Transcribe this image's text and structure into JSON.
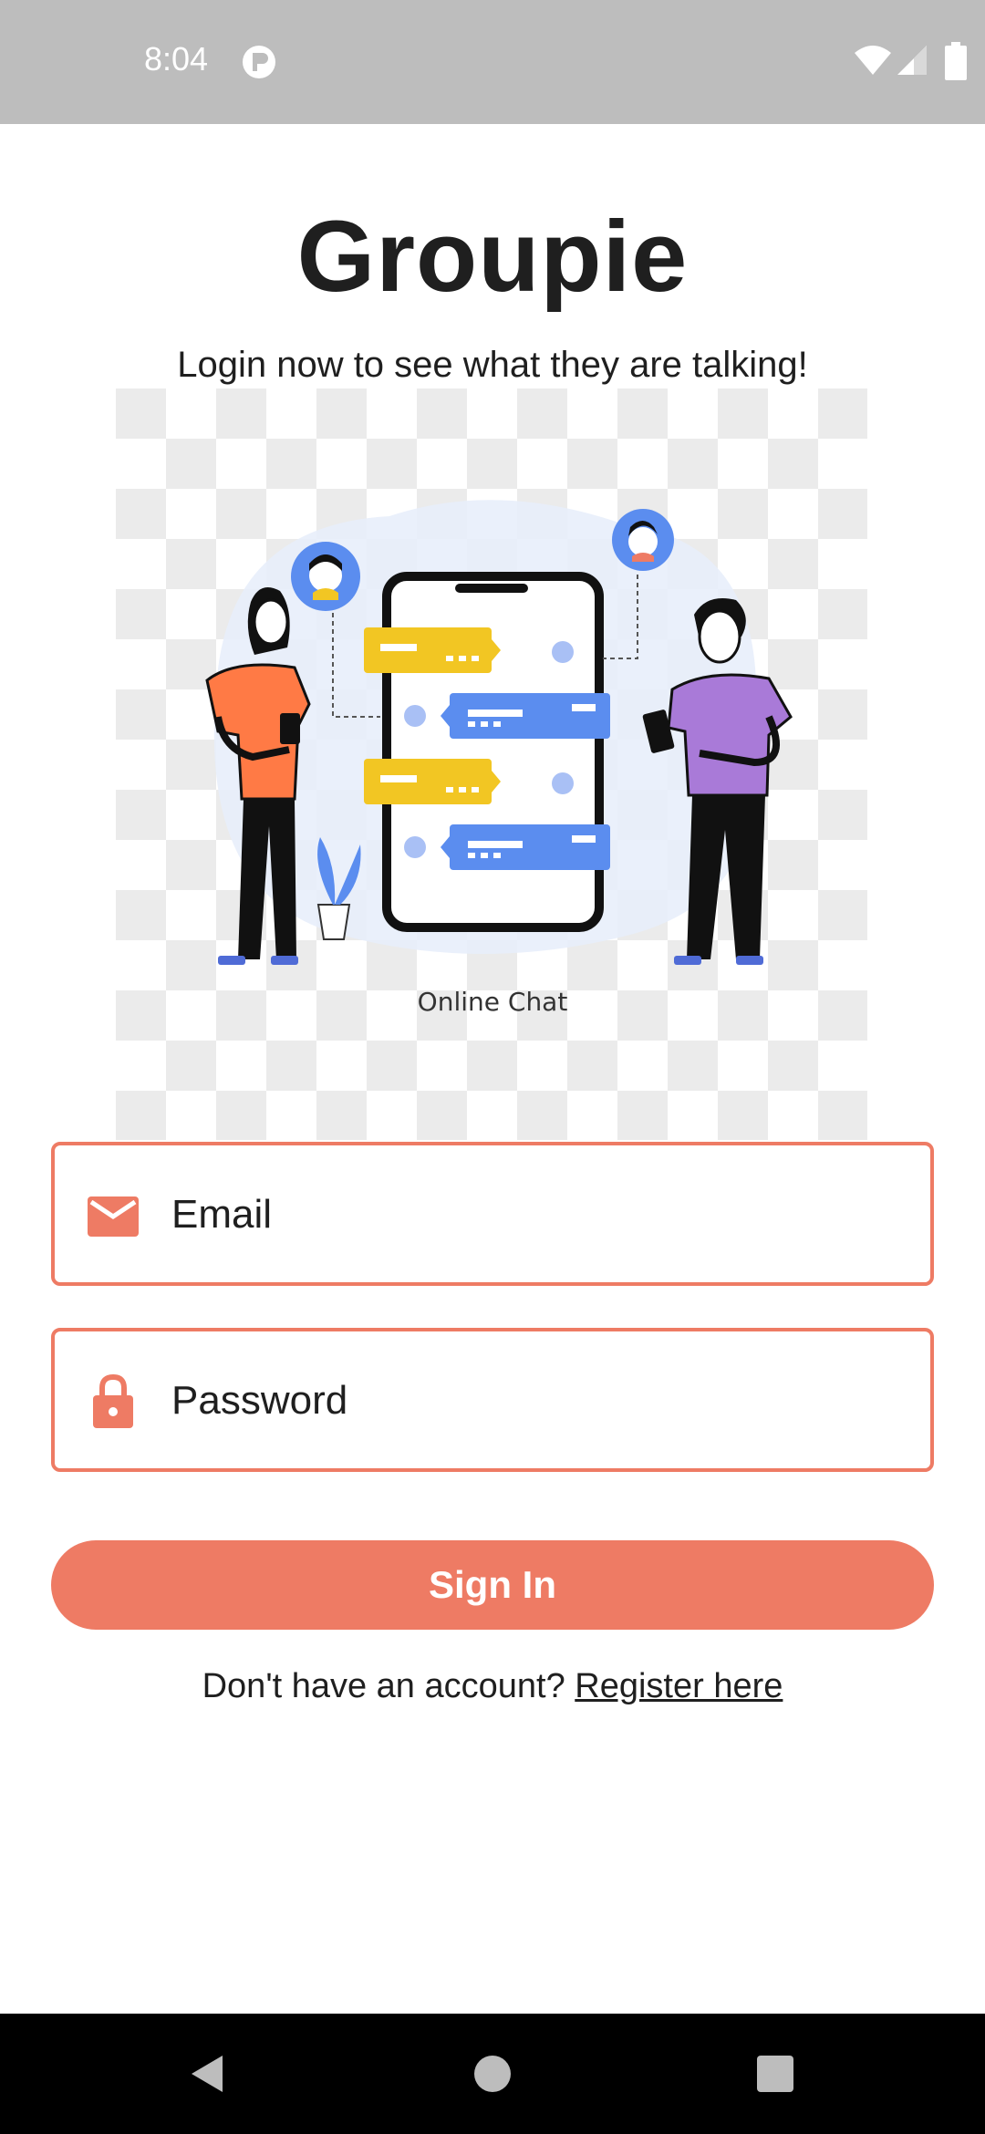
{
  "status_bar": {
    "time": "8:04",
    "app_icon": "app-notification-icon",
    "icons": [
      "wifi-icon",
      "signal-icon",
      "battery-icon"
    ]
  },
  "header": {
    "title": "Groupie",
    "subtitle": "Login now to see what they are talking!"
  },
  "illustration": {
    "caption": "Online Chat"
  },
  "form": {
    "email": {
      "placeholder": "Email",
      "value": "",
      "icon": "mail-icon"
    },
    "password": {
      "placeholder": "Password",
      "value": "",
      "icon": "lock-icon"
    },
    "signin_label": "Sign In"
  },
  "register": {
    "prompt": "Don't have an account?",
    "link_label": "Register here"
  },
  "colors": {
    "accent": "#ee7b64",
    "status_bar": "#bdbdbd",
    "nav_bar": "#000000"
  },
  "nav_bar": {
    "buttons": [
      "back-icon",
      "home-icon",
      "recents-icon"
    ]
  }
}
